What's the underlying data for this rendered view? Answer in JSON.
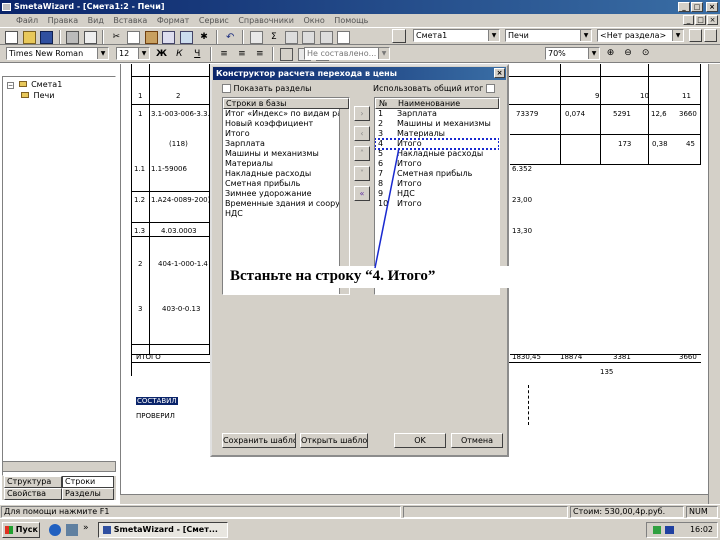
{
  "window": {
    "title": "SmetaWizard - [Смета1:2 - Печи]"
  },
  "menu": [
    "Файл",
    "Правка",
    "Вид",
    "Вставка",
    "Формат",
    "Сервис",
    "Справочники",
    "Окно",
    "Помощь"
  ],
  "toolbar2": {
    "font_name": "Times New Roman",
    "font_size": "12",
    "combo_mid": "Не составлено...",
    "zoom": "70%"
  },
  "toolbar1": {
    "combo_smeta": "Смета1",
    "combo_section": "Печи",
    "combo_nosection": "<Нет раздела>"
  },
  "tree": {
    "root": "Смета1",
    "child": "Печи"
  },
  "left_tabs": {
    "t1": "Структура",
    "t2": "Строки",
    "t3": "Свойства",
    "t4": "Разделы"
  },
  "sheet": {
    "cols": [
      "1",
      "2",
      "9",
      "10",
      "11"
    ],
    "r1": {
      "num": "1",
      "code": "3.1-003-006-3.3.4",
      "v1": "73379",
      "v2": "0,074",
      "v3": "5291",
      "v4": "12,6",
      "v5": "3660"
    },
    "r1b": {
      "note": "(118)",
      "v3": "173",
      "v4": "0,38",
      "v5": "45"
    },
    "r2": {
      "num": "1.1",
      "code": "1.1-59006",
      "v": "6.352"
    },
    "r3": {
      "num": "1.2",
      "code": "1.А24-0089-200)",
      "v": "23,00"
    },
    "r4": {
      "num": "1.3",
      "code": "4.03.0003",
      "v": "13,30"
    },
    "r5": {
      "num": "2",
      "code": "404-1-000-1.4"
    },
    "r6": {
      "num": "3",
      "code": "403-0-0.13"
    },
    "total": {
      "label": "ИТОГО",
      "v1": "1830,45",
      "v2": "18874",
      "v3": "3381",
      "v4": "3660",
      "v5": "135"
    },
    "hl1": "СОСТАВИЛ",
    "hl2": "ПРОВЕРИЛ"
  },
  "dialog": {
    "title": "Конструктор расчета перехода в цены",
    "chk1": "Использовать общий итог",
    "chk2": "Показать разделы",
    "left_header": "Строки в базы",
    "left_items": [
      "Итог «Индекс» по видам работ",
      "Новый коэффициент",
      "Итого",
      "Зарплата",
      "Машины и механизмы",
      "Материалы",
      "Накладные расходы",
      "Сметная прибыль",
      "Зимнее удорожание",
      "Временные здания и сооружения",
      "НДС"
    ],
    "right_header_num": "№",
    "right_header_name": "Наименование",
    "right_items": [
      {
        "n": "1",
        "t": "Зарплата"
      },
      {
        "n": "2",
        "t": "Машины и механизмы"
      },
      {
        "n": "3",
        "t": "Материалы"
      },
      {
        "n": "4",
        "t": "Итого"
      },
      {
        "n": "5",
        "t": "Накладные расходы"
      },
      {
        "n": "6",
        "t": "Итого"
      },
      {
        "n": "7",
        "t": "Сметная прибыль"
      },
      {
        "n": "8",
        "t": "Итого"
      },
      {
        "n": "9",
        "t": "НДС"
      },
      {
        "n": "10",
        "t": "Итого"
      }
    ],
    "btn_save": "Сохранить шаблон",
    "btn_open": "Открыть шаблон",
    "btn_ok": "OK",
    "btn_cancel": "Отмена"
  },
  "callout": "Встаньте на строку “4. Итого”",
  "status": {
    "help": "Для помощи нажмите F1",
    "price": "Стоим: 530,00,4р.руб.",
    "nm": "NUM"
  },
  "taskbar": {
    "start": "Пуск",
    "task": "SmetaWizard - [Смет...",
    "clock": "16:02"
  }
}
